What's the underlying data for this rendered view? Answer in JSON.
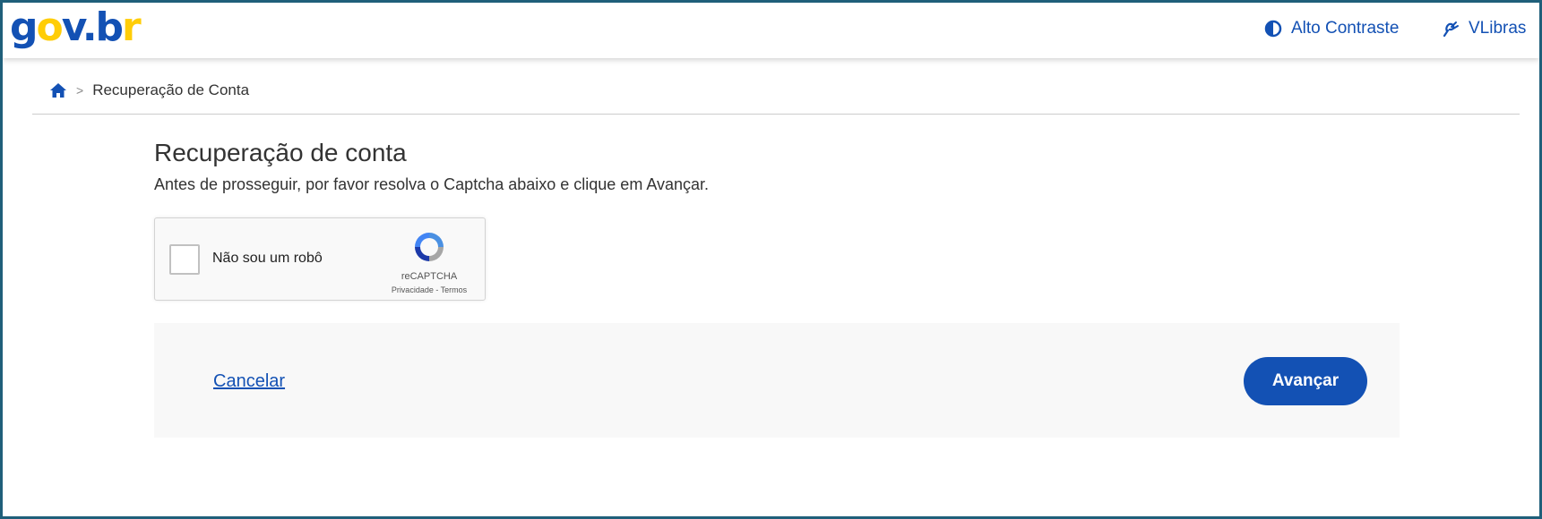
{
  "header": {
    "logo": {
      "g": "g",
      "o": "o",
      "v": "v",
      "dot": ".",
      "b": "b",
      "r": "r"
    },
    "contrast_label": "Alto Contraste",
    "vlibras_label": "VLibras"
  },
  "breadcrumb": {
    "home_icon": "home-icon",
    "separator": ">",
    "current": "Recuperação de Conta"
  },
  "main": {
    "title": "Recuperação de conta",
    "subtitle": "Antes de prosseguir, por favor resolva o Captcha abaixo e clique em Avançar."
  },
  "captcha": {
    "label": "Não sou um robô",
    "brand": "reCAPTCHA",
    "links": "Privacidade - Termos"
  },
  "actions": {
    "cancel_label": "Cancelar",
    "advance_label": "Avançar"
  },
  "colors": {
    "primary": "#1351b4",
    "accent_yellow": "#ffcd07",
    "frame_border": "#1f5f7a"
  }
}
